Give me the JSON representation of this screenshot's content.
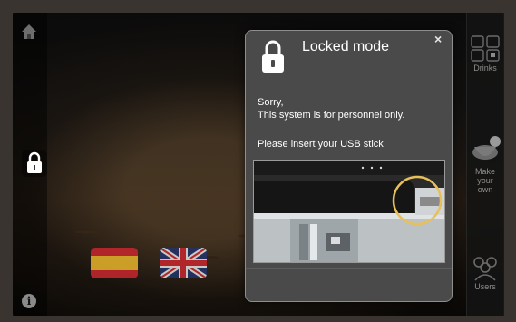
{
  "dialog": {
    "title": "Locked mode",
    "close_symbol": "×",
    "message_line1": "Sorry,",
    "message_line2": "This system is for personnel only.",
    "instruction": "Please insert your USB stick"
  },
  "right_nav": {
    "items": [
      {
        "label": "Drinks",
        "icon": "grid-cup-icon"
      },
      {
        "label_line1": "Make your",
        "label_line2": "own",
        "icon": "cup-icon"
      },
      {
        "label": "Users",
        "icon": "users-icon"
      }
    ]
  },
  "left_nav": {
    "icons": [
      "home-icon",
      "lock-icon",
      "info-icon"
    ],
    "info_symbol": "i"
  },
  "languages": [
    "spanish-flag",
    "uk-flag"
  ],
  "colors": {
    "dialog_bg": "#4a4a4a",
    "dialog_border": "#8e8e8e",
    "highlight_circle": "#e8c05a",
    "text": "#ffffff",
    "nav_text": "#8d8d8d"
  }
}
